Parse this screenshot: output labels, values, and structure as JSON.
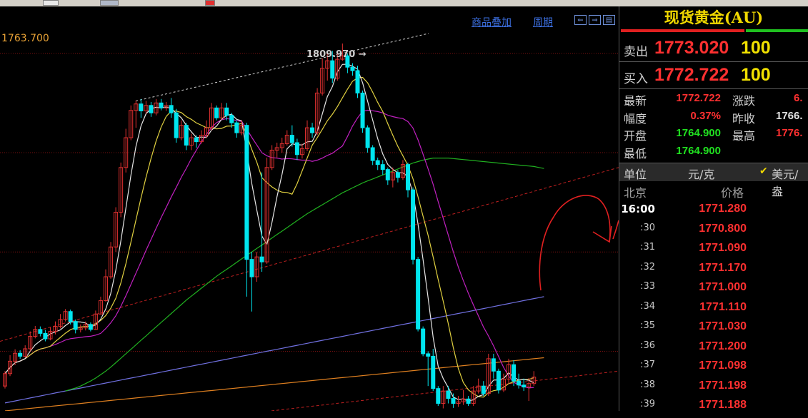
{
  "toolbar": {
    "buttons": 3
  },
  "chart_header": {
    "overlay_link": "商品叠加",
    "period_link": "周期"
  },
  "current_price_label": "1763.700",
  "high_marker": "1809.970 →",
  "panel": {
    "title": "现货黄金(AU)",
    "sell_label": "卖出",
    "sell_price": "1773.020",
    "sell_vol": "100",
    "buy_label": "买入",
    "buy_price": "1772.722",
    "buy_vol": "100",
    "stats": {
      "latest_label": "最新",
      "latest": "1772.722",
      "change_label": "涨跌",
      "change": "6.",
      "pct_label": "幅度",
      "pct": "0.37%",
      "prev_label": "昨收",
      "prev": "1766.",
      "open_label": "开盘",
      "open": "1764.900",
      "high_label": "最高",
      "high": "1776.",
      "low_label": "最低",
      "low": "1764.900"
    },
    "unit_label": "单位",
    "unit_value": "元/克",
    "usd_label": "美元/盎",
    "tick_header": {
      "city": "北京",
      "price": "价格"
    },
    "ticks": [
      {
        "time": "16:00",
        "price": "1771.280"
      },
      {
        "time": ":30",
        "price": "1770.800"
      },
      {
        "time": ":31",
        "price": "1771.090"
      },
      {
        "time": ":32",
        "price": "1771.170"
      },
      {
        "time": ":33",
        "price": "1771.000"
      },
      {
        "time": ":34",
        "price": "1771.110"
      },
      {
        "time": ":35",
        "price": "1771.030"
      },
      {
        "time": ":36",
        "price": "1771.200"
      },
      {
        "time": ":37",
        "price": "1771.098"
      },
      {
        "time": ":38",
        "price": "1771.198"
      },
      {
        "time": ":39",
        "price": "1771.188"
      }
    ]
  },
  "chart_data": {
    "type": "candlestick",
    "ylim": [
      1736,
      1816
    ],
    "series_high": 1809.97,
    "colors": {
      "up": "#e03030",
      "down": "#00e5ee",
      "ma5": "#e6e6e6",
      "ma10": "#e0d040",
      "ma20": "#c020c0",
      "ma60": "#20b020",
      "ma120": "#7070e0",
      "ma250": "#e08020"
    },
    "candles": [
      [
        1741.0,
        1743.5,
        1740.5,
        1744.0
      ],
      [
        1743.5,
        1746.0,
        1743.0,
        1747.2
      ],
      [
        1746.0,
        1747.6,
        1745.2,
        1748.4
      ],
      [
        1747.6,
        1747.0,
        1746.5,
        1748.2
      ],
      [
        1747.0,
        1748.5,
        1746.8,
        1749.2
      ],
      [
        1748.5,
        1751.0,
        1748.0,
        1752.0
      ],
      [
        1751.0,
        1752.4,
        1750.6,
        1753.1
      ],
      [
        1752.4,
        1751.6,
        1751.0,
        1753.0
      ],
      [
        1751.6,
        1750.5,
        1750.0,
        1752.3
      ],
      [
        1750.5,
        1752.0,
        1750.2,
        1752.8
      ],
      [
        1752.0,
        1753.0,
        1751.4,
        1754.0
      ],
      [
        1753.0,
        1754.4,
        1752.6,
        1755.5
      ],
      [
        1754.4,
        1756.0,
        1754.0,
        1756.5
      ],
      [
        1756.0,
        1754.0,
        1753.4,
        1756.4
      ],
      [
        1754.0,
        1752.4,
        1751.6,
        1754.4
      ],
      [
        1752.4,
        1752.7,
        1751.8,
        1753.4
      ],
      [
        1752.7,
        1753.4,
        1752.2,
        1754.0
      ],
      [
        1753.4,
        1752.4,
        1752.0,
        1753.8
      ],
      [
        1752.4,
        1755.5,
        1752.3,
        1756.2
      ],
      [
        1755.5,
        1758.2,
        1755.4,
        1759.0
      ],
      [
        1758.2,
        1763.0,
        1758.0,
        1764.5
      ],
      [
        1763.0,
        1769.0,
        1762.6,
        1770.0
      ],
      [
        1769.0,
        1776.0,
        1768.0,
        1777.0
      ],
      [
        1776.0,
        1785.0,
        1775.0,
        1786.0
      ],
      [
        1785.0,
        1791.0,
        1784.0,
        1792.8
      ],
      [
        1791.0,
        1796.5,
        1790.5,
        1797.5
      ],
      [
        1796.5,
        1797.8,
        1793.0,
        1798.5
      ],
      [
        1797.8,
        1796.4,
        1795.0,
        1798.8
      ],
      [
        1796.4,
        1797.5,
        1795.8,
        1798.4
      ],
      [
        1797.5,
        1796.0,
        1795.2,
        1798.2
      ],
      [
        1796.0,
        1798.0,
        1795.5,
        1798.8
      ],
      [
        1798.0,
        1797.0,
        1796.5,
        1798.8
      ],
      [
        1797.0,
        1797.5,
        1796.4,
        1798.2
      ],
      [
        1797.5,
        1796.0,
        1795.0,
        1799.0
      ],
      [
        1796.0,
        1791.0,
        1790.0,
        1796.8
      ],
      [
        1791.0,
        1793.5,
        1790.5,
        1794.5
      ],
      [
        1793.5,
        1789.5,
        1788.5,
        1794.0
      ],
      [
        1789.5,
        1791.0,
        1788.5,
        1791.8
      ],
      [
        1791.0,
        1790.2,
        1789.0,
        1791.5
      ],
      [
        1790.2,
        1791.5,
        1789.8,
        1792.5
      ],
      [
        1791.5,
        1793.0,
        1791.0,
        1794.5
      ],
      [
        1793.0,
        1797.0,
        1792.5,
        1798.0
      ],
      [
        1797.0,
        1795.0,
        1794.5,
        1797.5
      ],
      [
        1795.0,
        1797.0,
        1794.6,
        1798.0
      ],
      [
        1797.0,
        1795.5,
        1794.5,
        1798.0
      ],
      [
        1795.5,
        1794.0,
        1793.0,
        1796.0
      ],
      [
        1794.0,
        1792.0,
        1791.0,
        1794.5
      ],
      [
        1792.0,
        1793.5,
        1791.5,
        1794.5
      ],
      [
        1793.5,
        1766.5,
        1759.0,
        1794.0
      ],
      [
        1766.5,
        1763.0,
        1756.0,
        1768.0
      ],
      [
        1763.0,
        1767.0,
        1762.0,
        1768.0
      ],
      [
        1767.0,
        1766.0,
        1764.0,
        1784.0
      ],
      [
        1766.0,
        1785.0,
        1765.6,
        1787.0
      ],
      [
        1785.0,
        1788.5,
        1784.5,
        1789.5
      ],
      [
        1788.5,
        1789.0,
        1787.0,
        1790.0
      ],
      [
        1789.0,
        1789.8,
        1788.0,
        1791.0
      ],
      [
        1789.8,
        1791.5,
        1789.4,
        1792.5
      ],
      [
        1791.5,
        1790.0,
        1789.2,
        1793.5
      ],
      [
        1790.0,
        1787.6,
        1786.5,
        1790.8
      ],
      [
        1787.6,
        1788.8,
        1786.8,
        1789.8
      ],
      [
        1788.8,
        1793.0,
        1788.3,
        1794.5
      ],
      [
        1793.0,
        1792.0,
        1791.0,
        1794.0
      ],
      [
        1792.0,
        1800.0,
        1791.5,
        1801.0
      ],
      [
        1800.0,
        1805.0,
        1799.5,
        1807.0
      ],
      [
        1805.0,
        1806.5,
        1802.5,
        1808.0
      ],
      [
        1806.5,
        1803.0,
        1802.0,
        1808.5
      ],
      [
        1803.0,
        1806.8,
        1802.5,
        1808.5
      ],
      [
        1806.8,
        1807.5,
        1806.5,
        1809.97
      ],
      [
        1807.5,
        1805.2,
        1804.0,
        1808.0
      ],
      [
        1805.2,
        1804.5,
        1803.5,
        1806.0
      ],
      [
        1804.5,
        1800.0,
        1799.0,
        1805.5
      ],
      [
        1800.0,
        1793.0,
        1792.0,
        1800.5
      ],
      [
        1793.0,
        1789.0,
        1788.0,
        1793.5
      ],
      [
        1789.0,
        1786.4,
        1785.5,
        1789.5
      ],
      [
        1786.4,
        1785.6,
        1784.5,
        1787.0
      ],
      [
        1785.6,
        1784.6,
        1783.5,
        1786.5
      ],
      [
        1784.6,
        1782.5,
        1781.5,
        1785.0
      ],
      [
        1782.5,
        1784.0,
        1781.0,
        1785.0
      ],
      [
        1784.0,
        1783.0,
        1782.0,
        1784.5
      ],
      [
        1783.0,
        1785.6,
        1782.5,
        1786.5
      ],
      [
        1785.6,
        1780.5,
        1779.0,
        1786.0
      ],
      [
        1780.5,
        1766.5,
        1765.5,
        1781.0
      ],
      [
        1766.5,
        1752.5,
        1752.0,
        1767.0
      ],
      [
        1752.5,
        1747.5,
        1747.0,
        1753.0
      ],
      [
        1747.5,
        1747.0,
        1741.0,
        1748.0
      ],
      [
        1747.0,
        1740.5,
        1740.0,
        1748.5
      ],
      [
        1740.5,
        1737.5,
        1737.0,
        1741.0
      ],
      [
        1737.5,
        1740.0,
        1736.5,
        1741.0
      ],
      [
        1740.0,
        1738.5,
        1737.5,
        1741.0
      ],
      [
        1738.5,
        1737.5,
        1736.6,
        1739.5
      ],
      [
        1737.5,
        1737.8,
        1736.8,
        1739.0
      ],
      [
        1737.8,
        1738.4,
        1737.2,
        1740.2
      ],
      [
        1738.4,
        1737.5,
        1737.0,
        1739.0
      ],
      [
        1737.5,
        1740.0,
        1737.0,
        1741.0
      ],
      [
        1740.0,
        1741.0,
        1739.5,
        1742.5
      ],
      [
        1741.0,
        1739.5,
        1739.0,
        1742.0
      ],
      [
        1739.5,
        1746.5,
        1739.0,
        1747.5
      ],
      [
        1746.5,
        1744.0,
        1742.5,
        1747.5
      ],
      [
        1744.0,
        1740.2,
        1739.5,
        1744.5
      ],
      [
        1740.2,
        1742.4,
        1739.8,
        1743.5
      ],
      [
        1742.4,
        1745.3,
        1741.5,
        1746.5
      ],
      [
        1745.3,
        1742.0,
        1741.0,
        1746.2
      ],
      [
        1742.0,
        1741.2,
        1740.5,
        1743.5
      ],
      [
        1741.2,
        1740.8,
        1740.0,
        1742.5
      ],
      [
        1740.8,
        1741.5,
        1738.0,
        1742.6
      ],
      [
        1741.5,
        1742.8,
        1741.0,
        1744.0
      ]
    ],
    "ma60": [
      1740,
      1740.3,
      1740.6,
      1741,
      1741.5,
      1742,
      1742.6,
      1743.3,
      1744,
      1744.8,
      1745.7,
      1746.6,
      1747.5,
      1748.4,
      1749.3,
      1750.2,
      1751.1,
      1752,
      1752.9,
      1753.8,
      1754.7,
      1755.6,
      1756.5,
      1757.4,
      1758.3,
      1759.1,
      1759.9,
      1760.7,
      1761.5,
      1762.3,
      1763.1,
      1763.8,
      1764.5,
      1765.2,
      1765.9,
      1766.6,
      1767.3,
      1768,
      1768.7,
      1769.4,
      1770.1,
      1770.8,
      1771.5,
      1772.2,
      1772.9,
      1773.6,
      1774.3,
      1775,
      1775.7,
      1776.3,
      1776.9,
      1777.5,
      1778.1,
      1778.7,
      1779.3,
      1779.9,
      1780.4,
      1780.9,
      1781.4,
      1781.9,
      1782.3,
      1782.7,
      1783.1,
      1783.5,
      1783.9,
      1784.3,
      1784.7,
      1785.1,
      1785.5,
      1785.9,
      1786.2,
      1786.5,
      1786.7,
      1786.9,
      1786.9,
      1786.9,
      1786.9,
      1786.8,
      1786.7,
      1786.6,
      1786.5,
      1786.4,
      1786.3,
      1786.2,
      1786.1,
      1786.0,
      1785.9,
      1785.8,
      1785.7,
      1785.6,
      1785.5,
      1785.4,
      1785.3,
      1785.2,
      1785.0,
      1784.8
    ],
    "ma120": [
      1737.6,
      1737.8,
      1738.0,
      1738.2,
      1738.4,
      1738.6,
      1738.8,
      1739.0,
      1739.2,
      1739.4,
      1739.6,
      1739.8,
      1740.0,
      1740.2,
      1740.4,
      1740.6,
      1740.8,
      1741.0,
      1741.2,
      1741.4,
      1741.6,
      1741.8,
      1742.0,
      1742.2,
      1742.4,
      1742.6,
      1742.8,
      1743.0,
      1743.2,
      1743.4,
      1743.6,
      1743.8,
      1744.0,
      1744.2,
      1744.4,
      1744.6,
      1744.8,
      1745.0,
      1745.2,
      1745.4,
      1745.6,
      1745.8,
      1746.0,
      1746.2,
      1746.4,
      1746.6,
      1746.8,
      1747.0,
      1747.2,
      1747.4,
      1747.6,
      1747.8,
      1748.0,
      1748.2,
      1748.4,
      1748.6,
      1748.8,
      1749.0,
      1749.2,
      1749.4,
      1749.6,
      1749.8,
      1750.0,
      1750.2,
      1750.4,
      1750.6,
      1750.8,
      1751.0,
      1751.2,
      1751.4,
      1751.6,
      1751.8,
      1752.0,
      1752.2,
      1752.4,
      1752.6,
      1752.8,
      1753.0,
      1753.2,
      1753.4,
      1753.6,
      1753.8,
      1754.0,
      1754.2,
      1754.4,
      1754.6,
      1754.8,
      1755.0,
      1755.2,
      1755.4,
      1755.6,
      1755.8,
      1756.0,
      1756.2,
      1756.4,
      1756.6,
      1756.8,
      1757.0,
      1757.2,
      1757.4,
      1757.6,
      1757.8,
      1758.0,
      1758.2,
      1758.4,
      1758.6,
      1758.8,
      1759.0
    ],
    "ma250": [
      1736.0,
      1736.1,
      1736.2,
      1736.3,
      1736.4,
      1736.5,
      1736.6,
      1736.7,
      1736.8,
      1736.9,
      1737.0,
      1737.1,
      1737.2,
      1737.3,
      1737.4,
      1737.5,
      1737.6,
      1737.7,
      1737.8,
      1737.9,
      1738.0,
      1738.1,
      1738.2,
      1738.3,
      1738.4,
      1738.5,
      1738.6,
      1738.7,
      1738.8,
      1738.9,
      1739.0,
      1739.1,
      1739.2,
      1739.3,
      1739.4,
      1739.5,
      1739.6,
      1739.7,
      1739.8,
      1739.9,
      1740.0,
      1740.1,
      1740.2,
      1740.3,
      1740.4,
      1740.5,
      1740.6,
      1740.7,
      1740.8,
      1740.9,
      1741.0,
      1741.1,
      1741.2,
      1741.3,
      1741.4,
      1741.5,
      1741.6,
      1741.7,
      1741.8,
      1741.9,
      1742.0,
      1742.1,
      1742.2,
      1742.3,
      1742.4,
      1742.5,
      1742.6,
      1742.7,
      1742.8,
      1742.9,
      1743.0,
      1743.1,
      1743.2,
      1743.3,
      1743.4,
      1743.5,
      1743.6,
      1743.7,
      1743.8,
      1743.9,
      1744.0,
      1744.1,
      1744.2,
      1744.3,
      1744.4,
      1744.5,
      1744.6,
      1744.7,
      1744.8,
      1744.9,
      1745.0,
      1745.1,
      1745.2,
      1745.3,
      1745.4,
      1745.5,
      1745.6,
      1745.7,
      1745.8,
      1745.9,
      1746.0,
      1746.1,
      1746.2,
      1746.3,
      1746.4,
      1746.5,
      1746.6,
      1746.7
    ]
  }
}
